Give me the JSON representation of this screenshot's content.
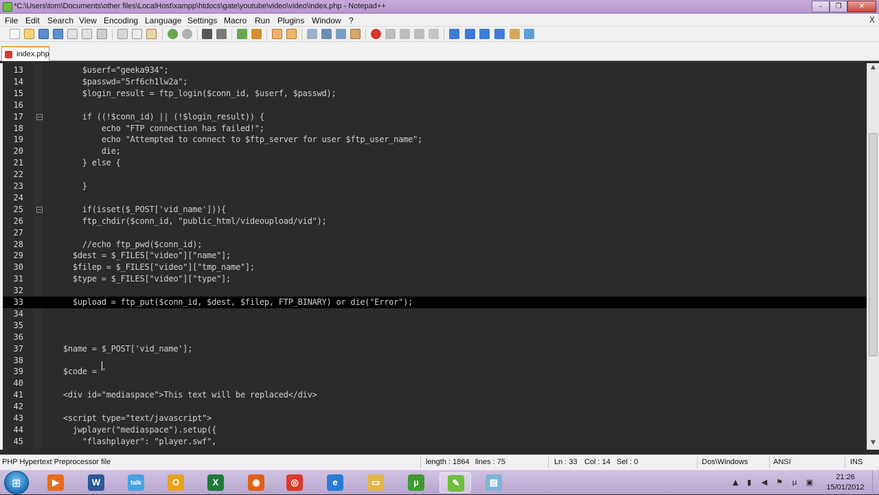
{
  "window": {
    "title": "*C:\\Users\\tom\\Documents\\other files\\LocalHost\\xampp\\htdocs\\gate\\youtube\\video\\video\\index.php - Notepad++",
    "minimize": "–",
    "maximize": "❐",
    "close": "✕"
  },
  "menu": [
    "File",
    "Edit",
    "Search",
    "View",
    "Encoding",
    "Language",
    "Settings",
    "Macro",
    "Run",
    "Plugins",
    "Window",
    "?"
  ],
  "menu_close": "X",
  "tab": {
    "label": "index.php"
  },
  "editor": {
    "current_line": 33,
    "lines": [
      {
        "n": "13",
        "fold": false,
        "code": "        $userf=\"geeka934\";"
      },
      {
        "n": "14",
        "fold": false,
        "code": "        $passwd=\"5rf6ch1lw2a\";"
      },
      {
        "n": "15",
        "fold": false,
        "code": "        $login_result = ftp_login($conn_id, $userf, $passwd);"
      },
      {
        "n": "16",
        "fold": false,
        "code": ""
      },
      {
        "n": "17",
        "fold": true,
        "code": "        if ((!$conn_id) || (!$login_result)) {"
      },
      {
        "n": "18",
        "fold": false,
        "code": "            echo \"FTP connection has failed!\";"
      },
      {
        "n": "19",
        "fold": false,
        "code": "            echo \"Attempted to connect to $ftp_server for user $ftp_user_name\";"
      },
      {
        "n": "20",
        "fold": false,
        "code": "            die;"
      },
      {
        "n": "21",
        "fold": false,
        "code": "        } else {"
      },
      {
        "n": "22",
        "fold": false,
        "code": ""
      },
      {
        "n": "23",
        "fold": false,
        "code": "        }"
      },
      {
        "n": "24",
        "fold": false,
        "code": ""
      },
      {
        "n": "25",
        "fold": true,
        "code": "        if(isset($_POST['vid_name'])){"
      },
      {
        "n": "26",
        "fold": false,
        "code": "        ftp_chdir($conn_id, \"public_html/videoupload/vid\");"
      },
      {
        "n": "27",
        "fold": false,
        "code": ""
      },
      {
        "n": "28",
        "fold": false,
        "code": "        //echo ftp_pwd($conn_id);"
      },
      {
        "n": "29",
        "fold": false,
        "code": "      $dest = $_FILES[\"video\"][\"name\"];"
      },
      {
        "n": "30",
        "fold": false,
        "code": "      $filep = $_FILES[\"video\"][\"tmp_name\"];"
      },
      {
        "n": "31",
        "fold": false,
        "code": "      $type = $_FILES[\"video\"][\"type\"];"
      },
      {
        "n": "32",
        "fold": false,
        "code": ""
      },
      {
        "n": "33",
        "fold": false,
        "code": "      $upload = ftp_put($conn_id, $dest, $filep, FTP_BINARY) or die(\"Error\");"
      },
      {
        "n": "34",
        "fold": false,
        "code": ""
      },
      {
        "n": "35",
        "fold": false,
        "code": ""
      },
      {
        "n": "36",
        "fold": false,
        "code": ""
      },
      {
        "n": "37",
        "fold": false,
        "code": "    $name = $_POST['vid_name'];"
      },
      {
        "n": "38",
        "fold": false,
        "code": ""
      },
      {
        "n": "39",
        "fold": false,
        "code": "    $code = '"
      },
      {
        "n": "40",
        "fold": false,
        "code": ""
      },
      {
        "n": "41",
        "fold": false,
        "code": "    <div id=\"mediaspace\">This text will be replaced</div>"
      },
      {
        "n": "42",
        "fold": false,
        "code": ""
      },
      {
        "n": "43",
        "fold": false,
        "code": "    <script type=\"text/javascript\">"
      },
      {
        "n": "44",
        "fold": false,
        "code": "      jwplayer(\"mediaspace\").setup({"
      },
      {
        "n": "45",
        "fold": false,
        "code": "        \"flashplayer\": \"player.swf\","
      }
    ]
  },
  "status": {
    "file_type": "PHP Hypertext Preprocessor file",
    "length": "length : 1864",
    "lines": "lines : 75",
    "ln": "Ln : 33",
    "col": "Col : 14",
    "sel": "Sel : 0",
    "eol": "Dos\\Windows",
    "encoding": "ANSI",
    "mode": "INS"
  },
  "taskbar": {
    "apps": [
      {
        "name": "windows-media-player",
        "glyph": "▶",
        "color": "#e86b1c"
      },
      {
        "name": "word",
        "glyph": "W",
        "color": "#2b5797"
      },
      {
        "name": "gtalk",
        "glyph": "talk",
        "color": "#4aa3df"
      },
      {
        "name": "outlook",
        "glyph": "O",
        "color": "#e8a31c"
      },
      {
        "name": "excel",
        "glyph": "X",
        "color": "#1f7a3a"
      },
      {
        "name": "firefox",
        "glyph": "◉",
        "color": "#e0601a"
      },
      {
        "name": "chrome",
        "glyph": "◎",
        "color": "#d93a2b"
      },
      {
        "name": "internet-explorer",
        "glyph": "e",
        "color": "#2a7bd1"
      },
      {
        "name": "explorer",
        "glyph": "▭",
        "color": "#e2b64a"
      },
      {
        "name": "utorrent",
        "glyph": "µ",
        "color": "#3f9a2f"
      },
      {
        "name": "notepadpp",
        "glyph": "✎",
        "color": "#6cbf3c"
      },
      {
        "name": "notepad",
        "glyph": "▤",
        "color": "#7fb3d8"
      }
    ],
    "time": "21:26",
    "date": "15/01/2012"
  },
  "colors": {
    "editor_bg": "#2b2b2b",
    "current_line_bg": "#000000",
    "titlebar": "#c6a9d9",
    "taskbar": "#b8a6d0"
  }
}
